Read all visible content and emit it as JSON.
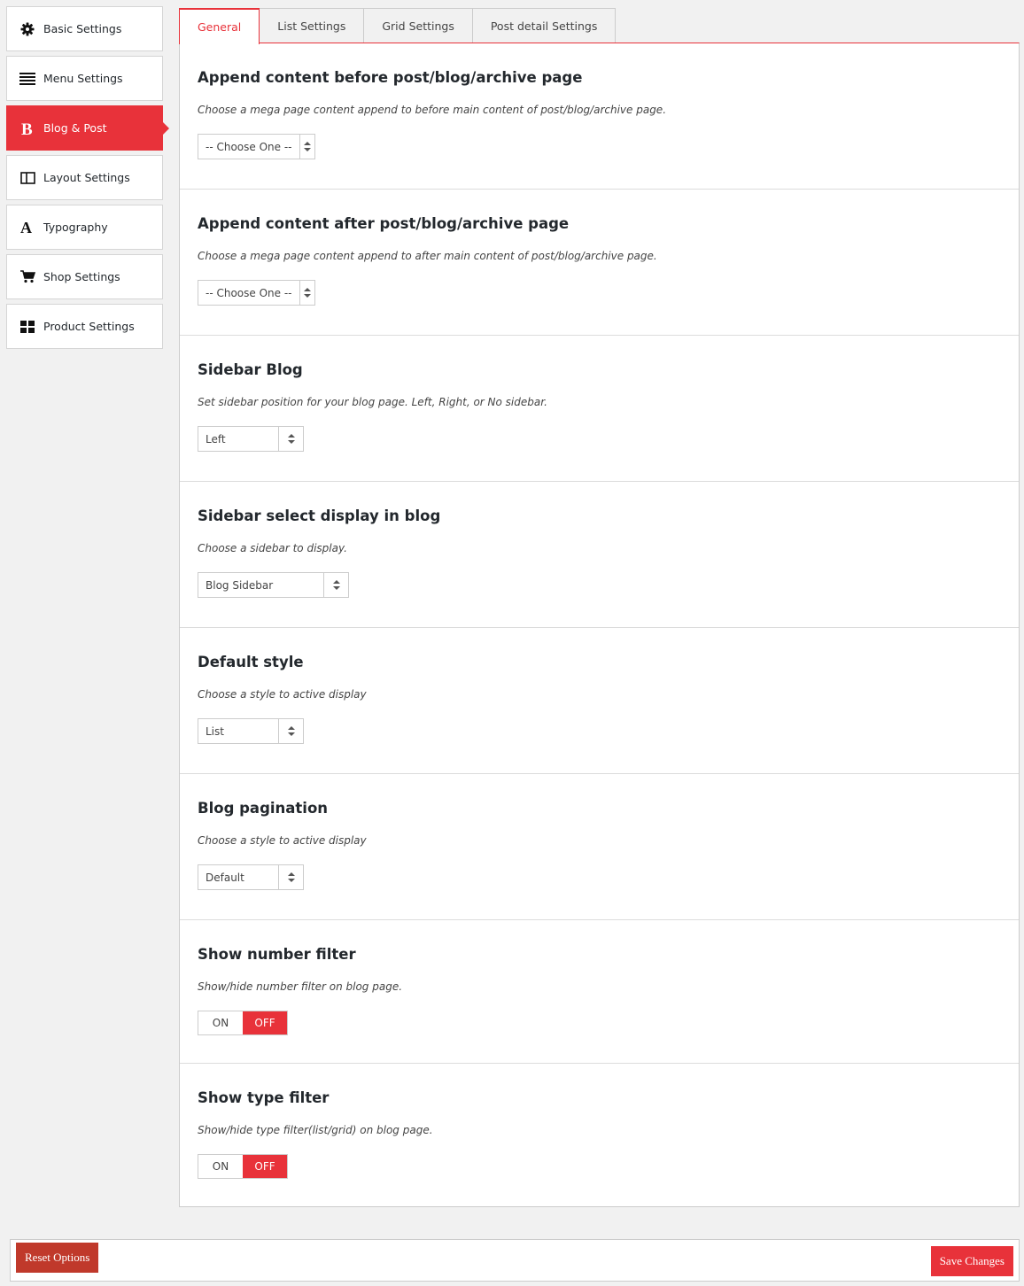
{
  "sidebar": {
    "items": [
      {
        "label": "Basic Settings",
        "icon": "gear-icon"
      },
      {
        "label": "Menu Settings",
        "icon": "menu-lines-icon"
      },
      {
        "label": "Blog & Post",
        "icon": "bold-b-icon",
        "active": true
      },
      {
        "label": "Layout Settings",
        "icon": "columns-icon"
      },
      {
        "label": "Typography",
        "icon": "letter-a-icon"
      },
      {
        "label": "Shop Settings",
        "icon": "cart-icon"
      },
      {
        "label": "Product Settings",
        "icon": "grid-icon"
      }
    ]
  },
  "tabs": [
    {
      "label": "General",
      "active": true
    },
    {
      "label": "List Settings"
    },
    {
      "label": "Grid Settings"
    },
    {
      "label": "Post detail Settings"
    }
  ],
  "sections": [
    {
      "title": "Append content before post/blog/archive page",
      "desc": "Choose a mega page content append to before main content of post/blog/archive page.",
      "value": "-- Choose One --"
    },
    {
      "title": "Append content after post/blog/archive page",
      "desc": "Choose a mega page content append to after main content of post/blog/archive page.",
      "value": "-- Choose One --"
    },
    {
      "title": "Sidebar Blog",
      "desc": "Set sidebar position for your blog page. Left, Right, or No sidebar.",
      "value": "Left"
    },
    {
      "title": "Sidebar select display in blog",
      "desc": "Choose a sidebar to display.",
      "value": "Blog Sidebar"
    },
    {
      "title": "Default style",
      "desc": "Choose a style to active display",
      "value": "List"
    },
    {
      "title": "Blog pagination",
      "desc": "Choose a style to active display",
      "value": "Default"
    },
    {
      "title": "Show number filter",
      "desc": "Show/hide number filter on blog page.",
      "on": "ON",
      "off": "OFF",
      "state": "off"
    },
    {
      "title": "Show type filter",
      "desc": "Show/hide type filter(list/grid) on blog page.",
      "on": "ON",
      "off": "OFF",
      "state": "off"
    }
  ],
  "footer": {
    "reset_label": "Reset Options",
    "save_label": "Save Changes"
  },
  "colors": {
    "accent": "#e8323a",
    "reset": "#c0392b"
  }
}
